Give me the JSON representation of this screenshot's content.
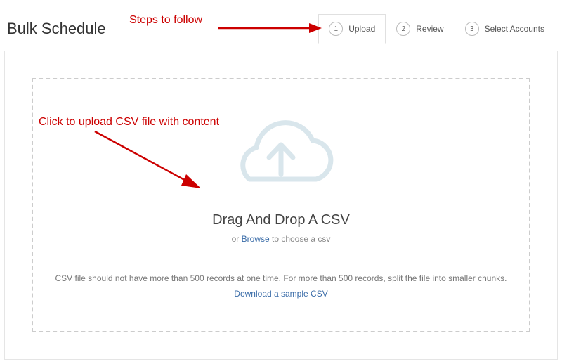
{
  "page": {
    "title": "Bulk Schedule"
  },
  "steps": {
    "items": [
      {
        "num": "1",
        "label": "Upload"
      },
      {
        "num": "2",
        "label": "Review"
      },
      {
        "num": "3",
        "label": "Select Accounts"
      }
    ]
  },
  "dropzone": {
    "title": "Drag And Drop A CSV",
    "sub_prefix": "or ",
    "browse_label": "Browse",
    "sub_suffix": " to choose a csv",
    "help_text": "CSV file should not have more than 500 records at one time. For more than 500 records, split the file into smaller chunks.",
    "sample_link": "Download a sample CSV"
  },
  "annotations": {
    "steps_hint": "Steps to follow",
    "upload_hint": "Click to upload CSV file with content"
  }
}
